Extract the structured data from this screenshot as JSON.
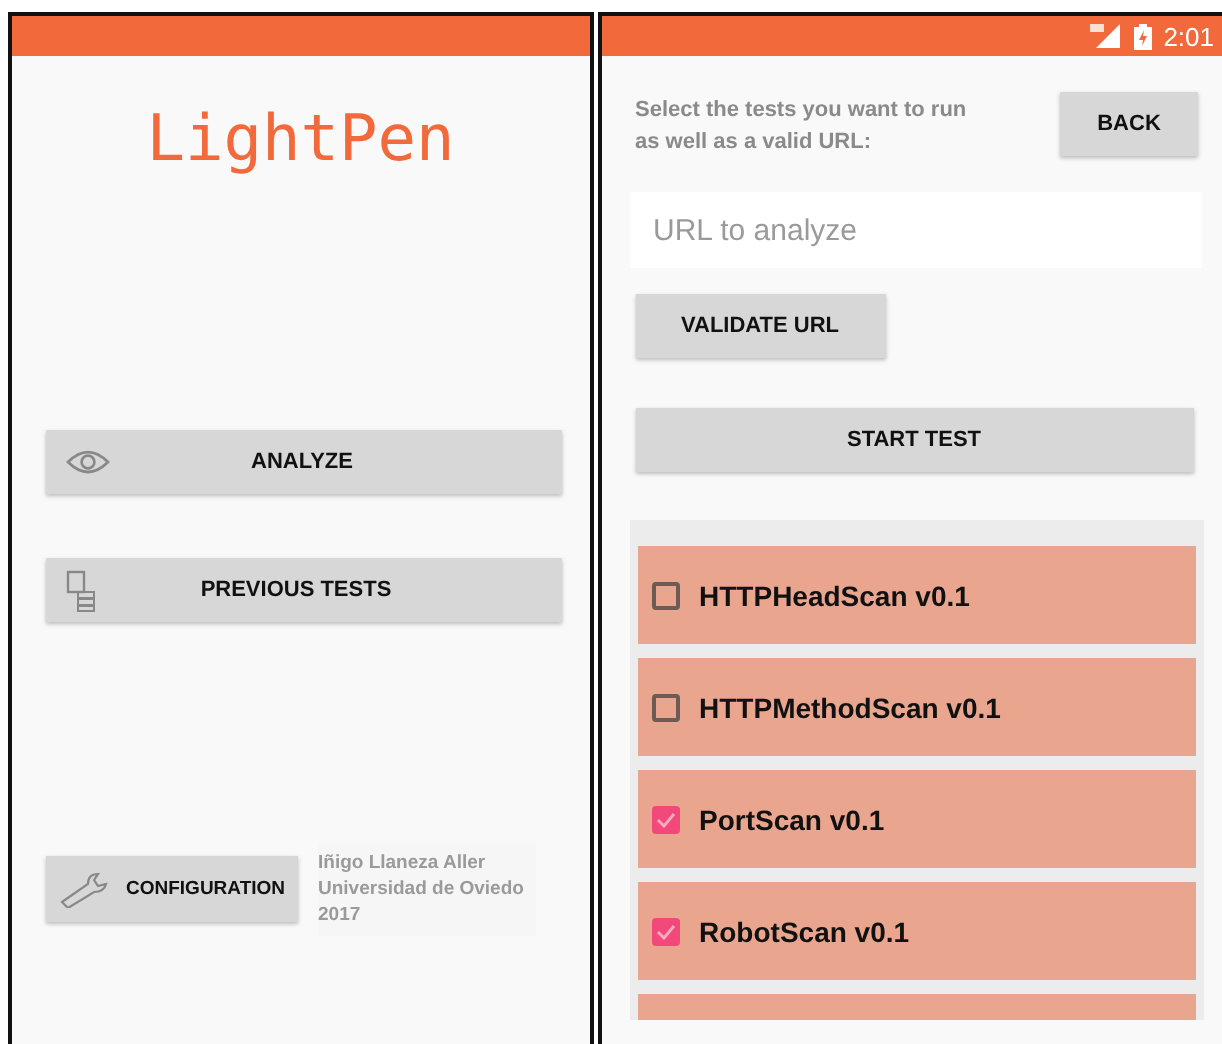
{
  "home_screen": {
    "title": "LightPen",
    "buttons": [
      {
        "label": "ANALYZE",
        "kind": "eye"
      },
      {
        "label": "PREVIOUS TESTS",
        "kind": "history"
      }
    ],
    "configuration_button": {
      "label": "CONFIGURATION"
    },
    "credits": [
      "Iñigo Llaneza Aller",
      "Universidad de Oviedo",
      "2017"
    ]
  },
  "test_screen": {
    "status_bar": {
      "time": "2:01"
    },
    "instructions": "Select the tests you want to run as well as a valid URL:",
    "back_button": "BACK",
    "url_field": {
      "placeholder": "URL to analyze"
    },
    "validate_button": "VALIDATE URL",
    "start_button": "START TEST",
    "tests": [
      {
        "label": "HTTPHeadScan v0.1",
        "checked": false
      },
      {
        "label": "HTTPMethodScan v0.1",
        "checked": false
      },
      {
        "label": "PortScan v0.1",
        "checked": true
      },
      {
        "label": "RobotScan v0.1",
        "checked": true
      }
    ]
  }
}
